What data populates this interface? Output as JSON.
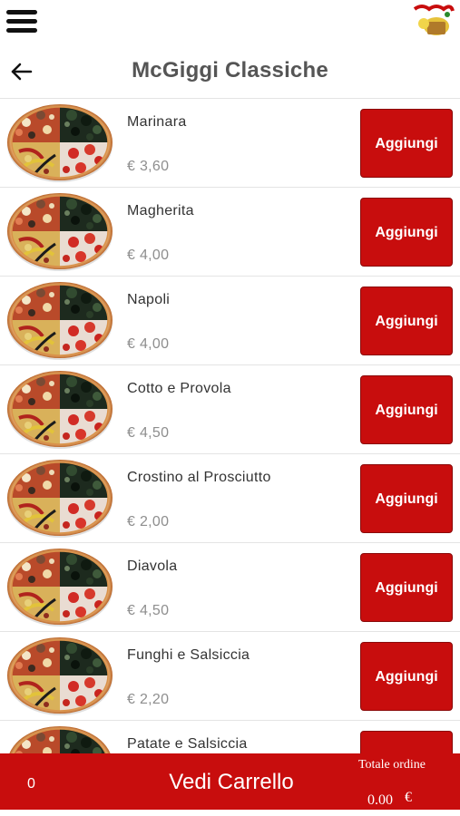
{
  "header": {
    "title": "McGiggi Classiche"
  },
  "icons": {
    "menu": "hamburger-menu-icon",
    "back": "arrow-left-icon",
    "logo": "restaurant-logo-icon",
    "item_image": "pizza-photo"
  },
  "colors": {
    "brand_red": "#c80d0d",
    "title_gray": "#555555",
    "price_gray": "#8e8e8e"
  },
  "items": [
    {
      "name": "Marinara",
      "price": "€ 3,60",
      "button": "Aggiungi"
    },
    {
      "name": "Magherita",
      "price": "€ 4,00",
      "button": "Aggiungi"
    },
    {
      "name": "Napoli",
      "price": "€ 4,00",
      "button": "Aggiungi"
    },
    {
      "name": "Cotto e Provola",
      "price": "€ 4,50",
      "button": "Aggiungi"
    },
    {
      "name": "Crostino al Prosciutto",
      "price": "€ 2,00",
      "button": "Aggiungi"
    },
    {
      "name": "Diavola",
      "price": "€ 4,50",
      "button": "Aggiungi"
    },
    {
      "name": "Funghi e Salsiccia",
      "price": "€ 2,20",
      "button": "Aggiungi"
    },
    {
      "name": "Patate e Salsiccia",
      "price": "",
      "button": ""
    }
  ],
  "footer": {
    "cart_count": "0",
    "cart_button": "Vedi Carrello",
    "total_label": "Totale ordine",
    "total_value": "0.00",
    "currency": "€"
  }
}
